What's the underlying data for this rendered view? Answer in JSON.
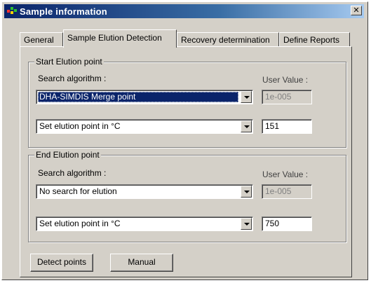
{
  "window": {
    "title": "Sample information",
    "close_label": "✕"
  },
  "tabs": [
    {
      "label": "General"
    },
    {
      "label": "Sample Elution Detection"
    },
    {
      "label": "Recovery determination"
    },
    {
      "label": "Define Reports"
    }
  ],
  "start_group": {
    "legend": "Start Elution point",
    "search_label": "Search algorithm :",
    "user_value_label": "User Value :",
    "algorithm_value": "DHA-SIMDIS Merge point",
    "user_value": "1e-005",
    "setpoint_value": "Set elution point in °C",
    "setpoint_number": "151"
  },
  "end_group": {
    "legend": "End Elution point",
    "search_label": "Search algorithm :",
    "user_value_label": "User Value :",
    "algorithm_value": "No search for elution",
    "user_value": "1e-005",
    "setpoint_value": "Set elution point in °C",
    "setpoint_number": "750"
  },
  "buttons": {
    "detect": "Detect points",
    "manual": "Manual"
  },
  "icons": {
    "app": "app-icon",
    "dropdown": "chevron-down-icon",
    "close": "close-icon"
  },
  "colors": {
    "titlebar": "#0a246a",
    "face": "#d4d0c8",
    "selection": "#0a246a"
  }
}
